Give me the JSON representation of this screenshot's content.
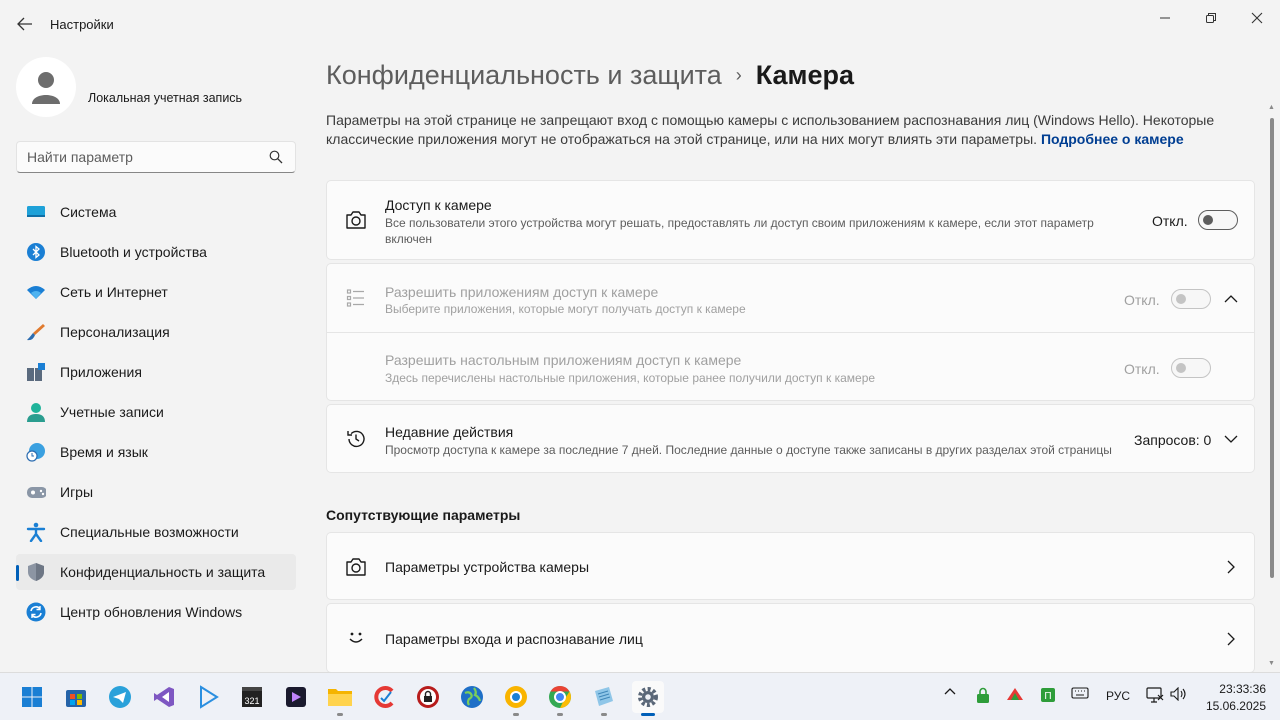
{
  "window": {
    "title": "Настройки",
    "back_label": "←"
  },
  "profile": {
    "name": "Локальная учетная запись"
  },
  "search": {
    "placeholder": "Найти параметр"
  },
  "sidebar": {
    "items": [
      {
        "label": "Система",
        "icon": "monitor-icon",
        "active": false
      },
      {
        "label": "Bluetooth и устройства",
        "icon": "bluetooth-icon",
        "active": false
      },
      {
        "label": "Сеть и Интернет",
        "icon": "wifi-icon",
        "active": false
      },
      {
        "label": "Персонализация",
        "icon": "brush-icon",
        "active": false
      },
      {
        "label": "Приложения",
        "icon": "apps-icon",
        "active": false
      },
      {
        "label": "Учетные записи",
        "icon": "person-icon",
        "active": false
      },
      {
        "label": "Время и язык",
        "icon": "globe-clock-icon",
        "active": false
      },
      {
        "label": "Игры",
        "icon": "gamepad-icon",
        "active": false
      },
      {
        "label": "Специальные возможности",
        "icon": "accessibility-icon",
        "active": false
      },
      {
        "label": "Конфиденциальность и защита",
        "icon": "shield-icon",
        "active": true
      },
      {
        "label": "Центр обновления Windows",
        "icon": "update-icon",
        "active": false
      }
    ]
  },
  "breadcrumb": {
    "parent": "Конфиденциальность и защита",
    "separator": "›",
    "current": "Камера"
  },
  "description": {
    "text": "Параметры на этой странице не запрещают вход с помощью камеры с использованием распознавания лиц (Windows Hello). Некоторые классические приложения могут не отображаться на этой странице, или на них могут влиять эти параметры.",
    "link": "Подробнее о камере"
  },
  "settings": {
    "camera_access": {
      "title": "Доступ к камере",
      "subtitle": "Все пользователи этого устройства могут решать, предоставлять ли доступ своим приложениям к камере, если этот параметр включен",
      "state": "Откл.",
      "on": false
    },
    "apps_access": {
      "title": "Разрешить приложениям доступ к камере",
      "subtitle": "Выберите приложения, которые могут получать доступ к камере",
      "state": "Откл.",
      "on": false,
      "disabled": true
    },
    "desktop_apps_access": {
      "title": "Разрешить настольным приложениям доступ к камере",
      "subtitle": "Здесь перечислены настольные приложения, которые ранее получили доступ к камере",
      "state": "Откл.",
      "on": false,
      "disabled": true
    },
    "recent_activity": {
      "title": "Недавние действия",
      "subtitle": "Просмотр доступа к камере за последние 7 дней. Последние данные о доступе также записаны в других разделах этой страницы",
      "value": "Запросов: 0"
    }
  },
  "related": {
    "heading": "Сопутствующие параметры",
    "items": [
      {
        "label": "Параметры устройства камеры",
        "icon": "camera-icon"
      },
      {
        "label": "Параметры входа и распознавание лиц",
        "icon": "smile-icon"
      }
    ]
  },
  "taskbar": {
    "apps": [
      "start-icon",
      "store-icon",
      "telegram-icon",
      "visual-studio-icon",
      "media-player-icon",
      "video-editor-icon",
      "dvd-icon",
      "file-explorer-icon",
      "ccleaner-icon",
      "lock-app-icon",
      "globe-browser-icon",
      "chrome-canary-icon",
      "chrome-icon",
      "notepad-icon",
      "settings-icon"
    ],
    "tray": {
      "language": "РУС",
      "time": "23:33:36",
      "date": "15.06.2025"
    }
  },
  "colors": {
    "accent": "#005fb8",
    "link": "#003e92",
    "background": "#f3f3f3",
    "card": "#fbfbfb"
  }
}
